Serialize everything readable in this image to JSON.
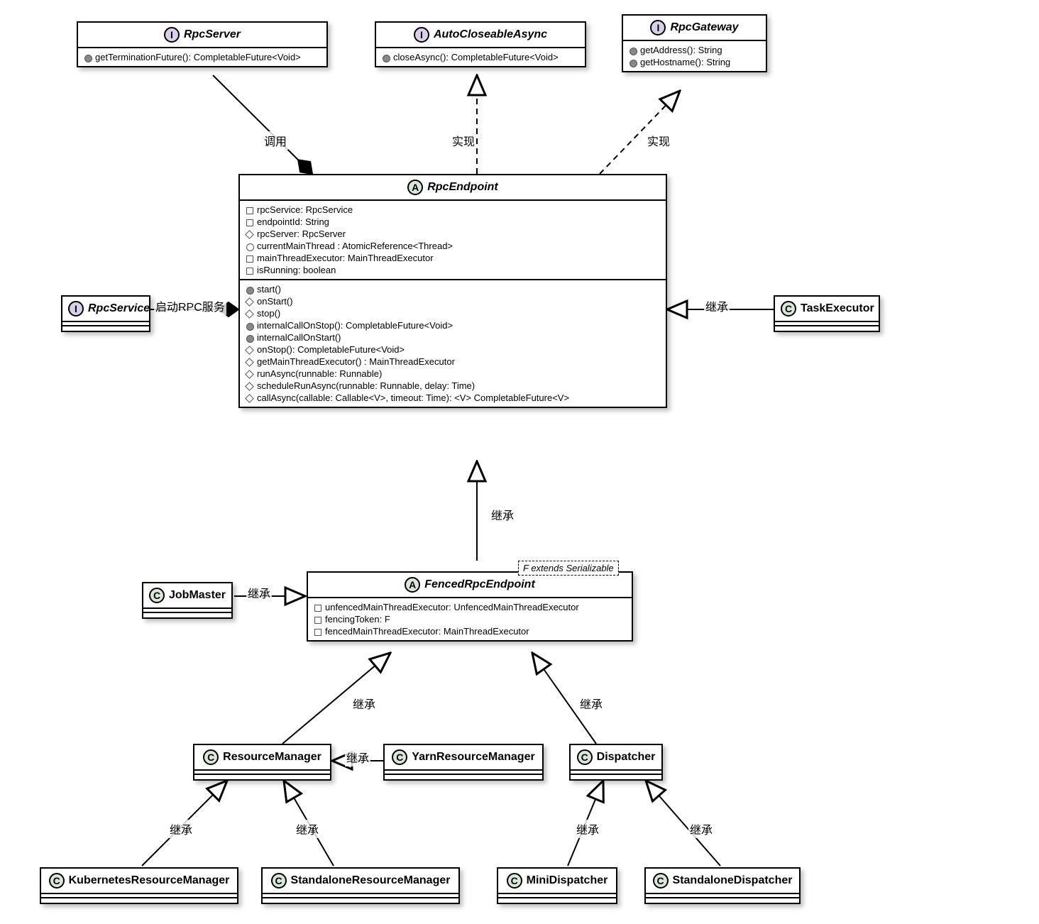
{
  "classes": {
    "rpcServer": {
      "stereotype": "I",
      "name": "RpcServer",
      "methods": [
        {
          "vis": "circle-filled",
          "sig": "getTerminationFuture(): CompletableFuture<Void>"
        }
      ]
    },
    "autoCloseableAsync": {
      "stereotype": "I",
      "name": "AutoCloseableAsync",
      "methods": [
        {
          "vis": "circle-filled",
          "sig": "closeAsync(): CompletableFuture<Void>"
        }
      ]
    },
    "rpcGateway": {
      "stereotype": "I",
      "name": "RpcGateway",
      "methods": [
        {
          "vis": "circle-filled",
          "sig": "getAddress(): String"
        },
        {
          "vis": "circle-filled",
          "sig": "getHostname(): String"
        }
      ]
    },
    "rpcEndpoint": {
      "stereotype": "A",
      "name": "RpcEndpoint",
      "fields": [
        {
          "vis": "square",
          "sig": "rpcService: RpcService"
        },
        {
          "vis": "square",
          "sig": "endpointId: String"
        },
        {
          "vis": "diamond",
          "sig": "rpcServer: RpcServer"
        },
        {
          "vis": "circle",
          "sig": "currentMainThread : AtomicReference<Thread>"
        },
        {
          "vis": "square",
          "sig": "mainThreadExecutor: MainThreadExecutor"
        },
        {
          "vis": "square",
          "sig": "isRunning: boolean"
        }
      ],
      "methods": [
        {
          "vis": "circle-filled",
          "sig": "start()"
        },
        {
          "vis": "diamond",
          "sig": "onStart()"
        },
        {
          "vis": "diamond",
          "sig": "stop()"
        },
        {
          "vis": "circle-filled",
          "sig": "internalCallOnStop(): CompletableFuture<Void>"
        },
        {
          "vis": "circle-filled",
          "sig": "internalCallOnStart()"
        },
        {
          "vis": "diamond",
          "sig": "onStop(): CompletableFuture<Void>"
        },
        {
          "vis": "diamond",
          "sig": "getMainThreadExecutor() : MainThreadExecutor"
        },
        {
          "vis": "diamond",
          "sig": "runAsync(runnable: Runnable)"
        },
        {
          "vis": "diamond",
          "sig": "scheduleRunAsync(runnable: Runnable, delay: Time)"
        },
        {
          "vis": "diamond",
          "sig": "callAsync(callable: Callable<V>, timeout: Time): <V> CompletableFuture<V>"
        }
      ]
    },
    "rpcService": {
      "stereotype": "I",
      "name": "RpcService"
    },
    "taskExecutor": {
      "stereotype": "C",
      "name": "TaskExecutor"
    },
    "fencedRpcEndpoint": {
      "stereotype": "A",
      "name": "FencedRpcEndpoint",
      "note": "F extends Serializable",
      "fields": [
        {
          "vis": "square",
          "sig": "unfencedMainThreadExecutor: UnfencedMainThreadExecutor"
        },
        {
          "vis": "square",
          "sig": "fencingToken: F"
        },
        {
          "vis": "square",
          "sig": "fencedMainThreadExecutor: MainThreadExecutor"
        }
      ]
    },
    "jobMaster": {
      "stereotype": "C",
      "name": "JobMaster"
    },
    "resourceManager": {
      "stereotype": "C",
      "name": "ResourceManager"
    },
    "yarnResourceManager": {
      "stereotype": "C",
      "name": "YarnResourceManager"
    },
    "dispatcher": {
      "stereotype": "C",
      "name": "Dispatcher"
    },
    "kubernetesResourceManager": {
      "stereotype": "C",
      "name": "KubernetesResourceManager"
    },
    "standaloneResourceManager": {
      "stereotype": "C",
      "name": "StandaloneResourceManager"
    },
    "miniDispatcher": {
      "stereotype": "C",
      "name": "MiniDispatcher"
    },
    "standaloneDispatcher": {
      "stereotype": "C",
      "name": "StandaloneDispatcher"
    }
  },
  "labels": {
    "call": "调用",
    "implement1": "实现",
    "implement2": "实现",
    "startRpc": "启动RPC服务",
    "inherit1": "继承",
    "inherit2": "继承",
    "inherit3": "继承",
    "inherit4": "继承",
    "inherit5": "继承",
    "inherit6": "继承",
    "inherit7": "继承",
    "inherit8": "继承",
    "inherit9": "继承",
    "inherit10": "继承"
  }
}
